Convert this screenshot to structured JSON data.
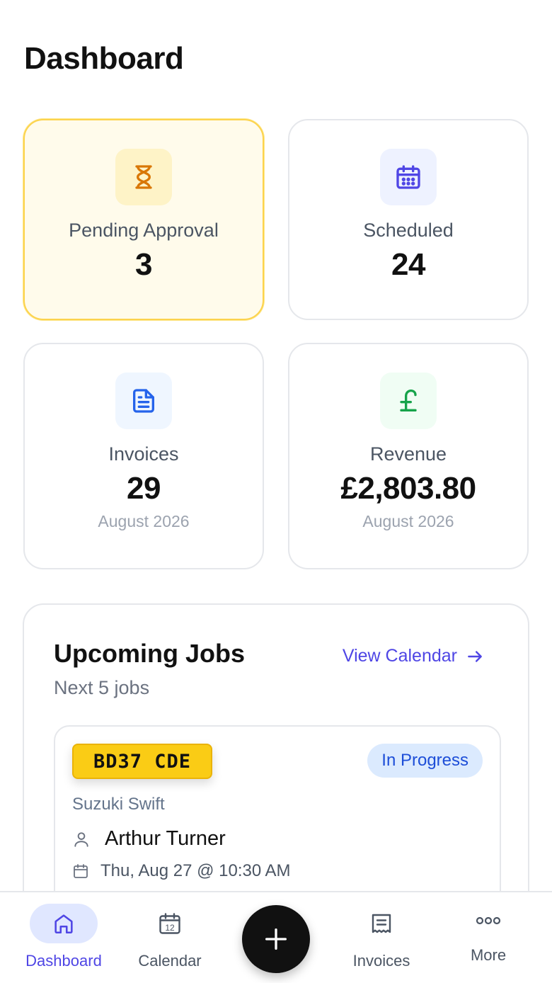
{
  "page": {
    "title": "Dashboard"
  },
  "stats": [
    {
      "label": "Pending Approval",
      "value": "3",
      "sub": "",
      "icon": "hourglass-icon",
      "color": "#d97706"
    },
    {
      "label": "Scheduled",
      "value": "24",
      "sub": "",
      "icon": "calendar-icon",
      "color": "#4f46e5"
    },
    {
      "label": "Invoices",
      "value": "29",
      "sub": "August 2026",
      "icon": "document-icon",
      "color": "#2563eb"
    },
    {
      "label": "Revenue",
      "value": "£2,803.80",
      "sub": "August 2026",
      "icon": "pound-icon",
      "color": "#16a34a"
    }
  ],
  "upcoming": {
    "title": "Upcoming Jobs",
    "subtitle": "Next 5 jobs",
    "view_calendar": "View Calendar",
    "jobs": [
      {
        "plate": "BD37 CDE",
        "status": "In Progress",
        "vehicle": "Suzuki Swift",
        "customer": "Arthur Turner",
        "datetime": "Thu, Aug 27 @ 10:30 AM"
      }
    ]
  },
  "nav": {
    "items": [
      {
        "label": "Dashboard",
        "icon": "home-icon",
        "active": true
      },
      {
        "label": "Calendar",
        "icon": "calendar-icon"
      },
      {
        "label": "",
        "icon": "plus-icon"
      },
      {
        "label": "Invoices",
        "icon": "receipt-icon"
      },
      {
        "label": "More",
        "icon": "more-icon"
      }
    ],
    "calendar_day": "12"
  },
  "colors": {
    "accent": "#4f46e5",
    "pending_bg": "#fffbeb",
    "plate": "#facc15",
    "status_bg": "#dbeafe"
  }
}
